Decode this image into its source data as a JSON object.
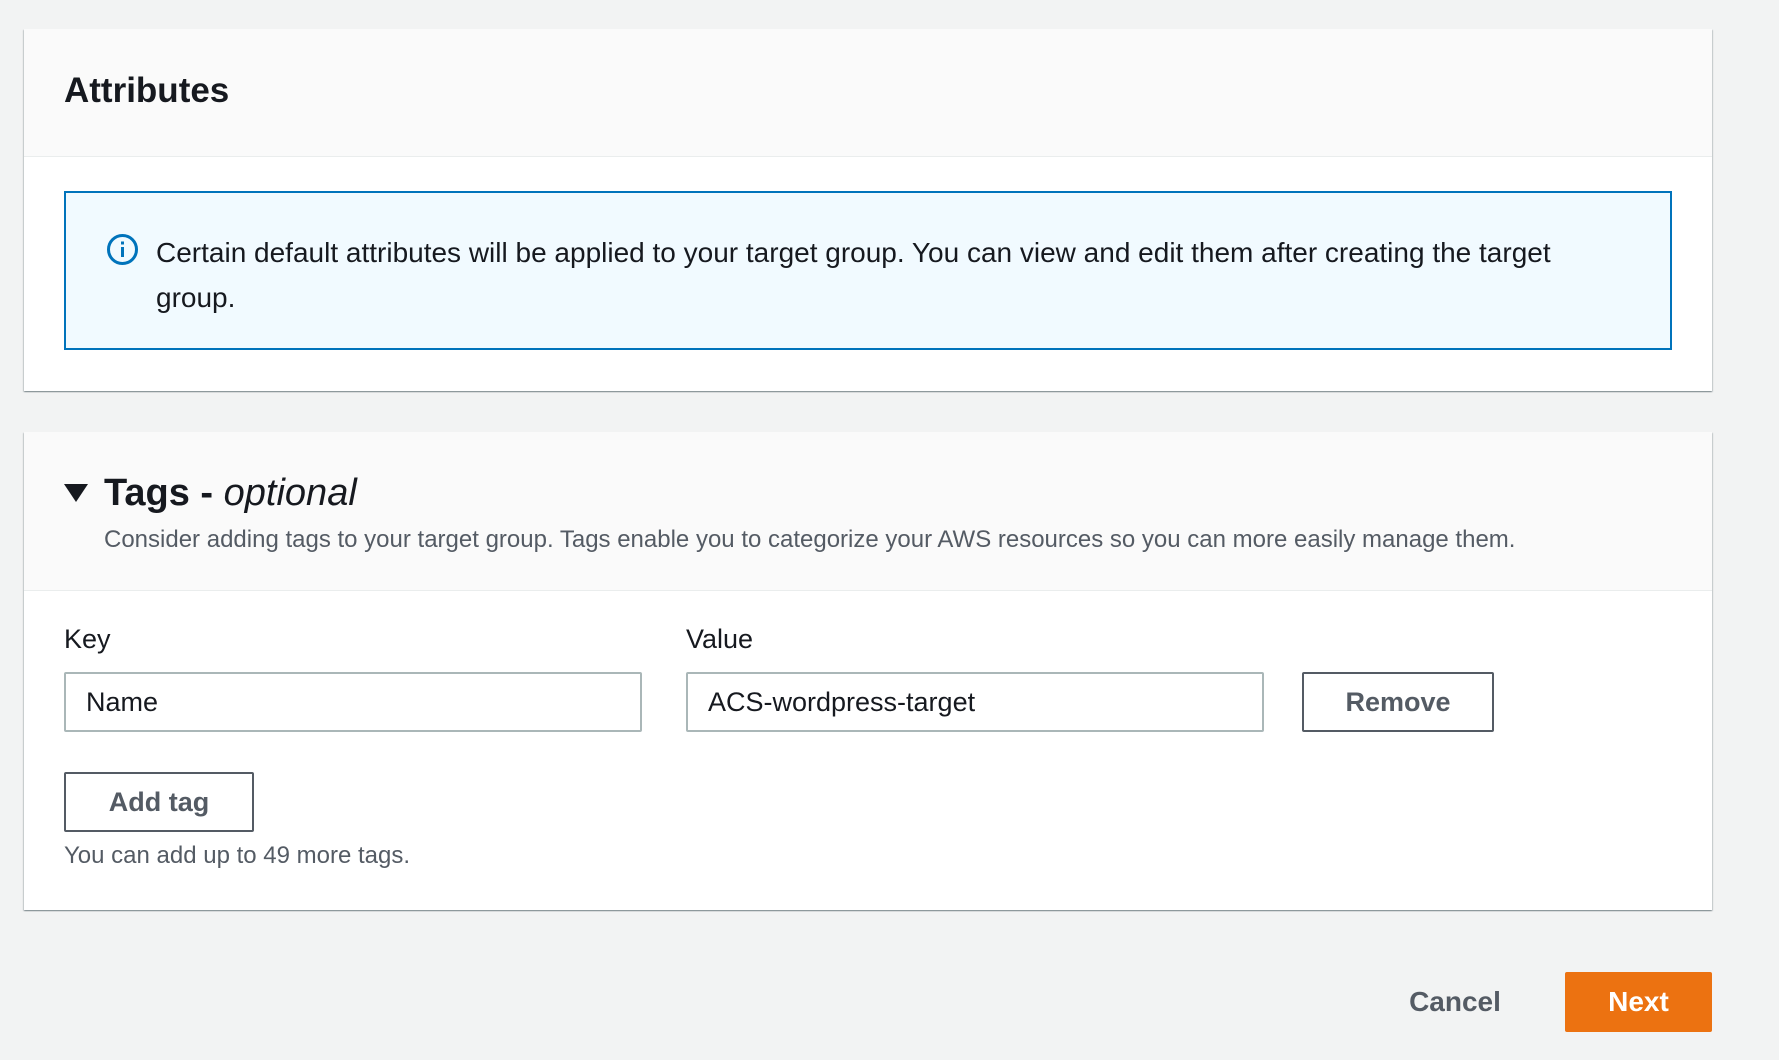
{
  "attributes": {
    "title": "Attributes",
    "info_text": "Certain default attributes will be applied to your target group. You can view and edit them after creating the target group."
  },
  "tags": {
    "title": "Tags -",
    "title_optional": "optional",
    "description": "Consider adding tags to your target group. Tags enable you to categorize your AWS resources so you can more easily manage them.",
    "key_label": "Key",
    "value_label": "Value",
    "rows": [
      {
        "key": "Name",
        "value": "ACS-wordpress-target"
      }
    ],
    "remove_label": "Remove",
    "add_tag_label": "Add tag",
    "hint": "You can add up to 49 more tags."
  },
  "footer": {
    "cancel_label": "Cancel",
    "next_label": "Next"
  },
  "colors": {
    "primary": "#ec7211",
    "info_border": "#0073bb",
    "info_bg": "#f1faff",
    "page_bg": "#f2f3f3"
  },
  "icons": {
    "info": "info-circle-icon",
    "caret": "caret-down-icon"
  }
}
